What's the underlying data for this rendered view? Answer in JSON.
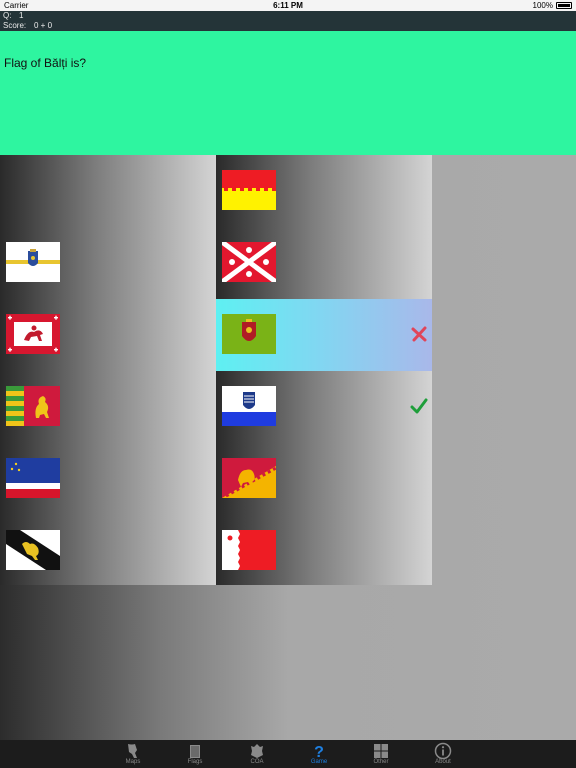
{
  "status": {
    "carrier": "Carrier",
    "time": "6:11 PM",
    "battery": "100%"
  },
  "info": {
    "q_label": "Q:",
    "q_value": "1",
    "score_label": "Score:",
    "score_value": "0 + 0"
  },
  "question": {
    "text": "Flag of Bălți is?"
  },
  "colors": {
    "question_bg": "#2ef5a0",
    "highlight": "#5ef0f2",
    "tab_active": "#1e7fe0"
  },
  "options_left": [
    {
      "flag": "blank"
    },
    {
      "flag": "white-yellow-stripe-coa"
    },
    {
      "flag": "red-white-crosses-horseman"
    },
    {
      "flag": "green-yellow-stripes-red-lion"
    },
    {
      "flag": "blue-white-red-stars"
    },
    {
      "flag": "white-black-diagonal-lion"
    }
  ],
  "options_right": [
    {
      "flag": "red-yellow-battlement"
    },
    {
      "flag": "red-white-saltire-lilies"
    },
    {
      "flag": "green-red-shield",
      "state": "wrong",
      "mark_icon": "cross-icon"
    },
    {
      "flag": "white-blue-coa",
      "state": "correct",
      "mark_icon": "check-icon"
    },
    {
      "flag": "red-yellow-diagonal-lion"
    },
    {
      "flag": "white-red-serrated"
    }
  ],
  "tabs": [
    {
      "label": "Maps",
      "icon": "map-icon"
    },
    {
      "label": "Flags",
      "icon": "flag-book-icon"
    },
    {
      "label": "COA",
      "icon": "coat-of-arms-icon"
    },
    {
      "label": "Game",
      "icon": "question-icon",
      "active": true
    },
    {
      "label": "Other",
      "icon": "grid-icon"
    },
    {
      "label": "About",
      "icon": "info-icon"
    }
  ]
}
